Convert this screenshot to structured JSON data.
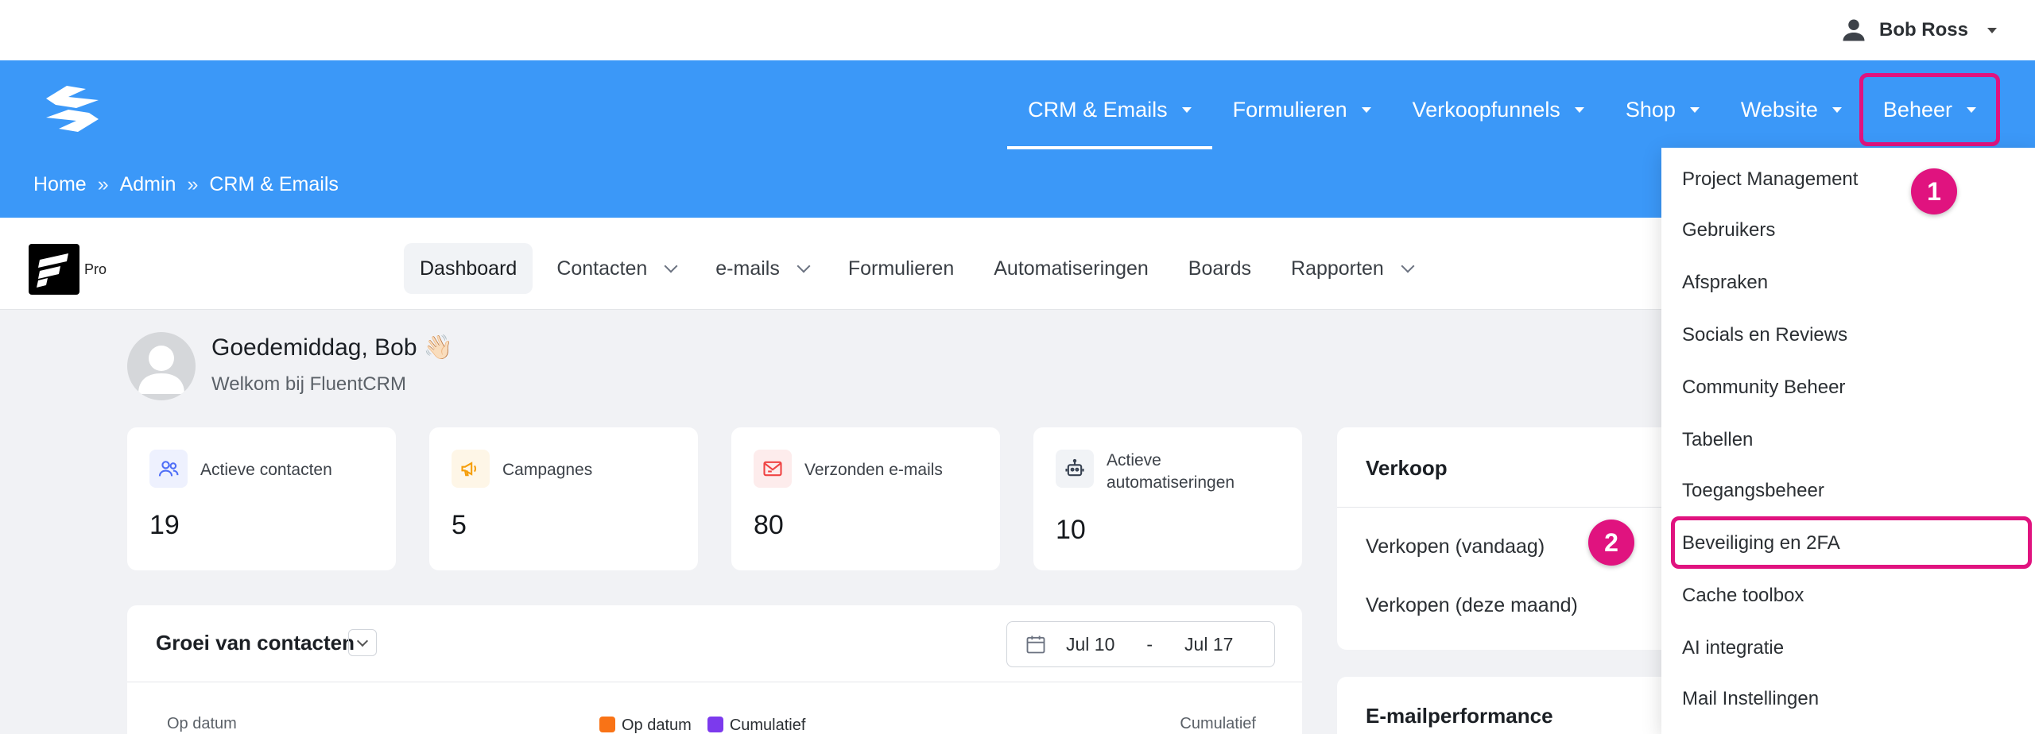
{
  "user": {
    "name": "Bob Ross",
    "icon": "user-icon"
  },
  "nav": {
    "items": [
      {
        "label": "CRM & Emails",
        "active": true
      },
      {
        "label": "Formulieren"
      },
      {
        "label": "Verkoopfunnels"
      },
      {
        "label": "Shop"
      },
      {
        "label": "Website"
      },
      {
        "label": "Beheer",
        "highlighted": true
      }
    ]
  },
  "breadcrumb": {
    "items": [
      "Home",
      "Admin",
      "CRM & Emails"
    ],
    "separator": "»"
  },
  "crm": {
    "pro_label": "Pro",
    "tabs": [
      {
        "label": "Dashboard",
        "active": true
      },
      {
        "label": "Contacten",
        "has_dropdown": true
      },
      {
        "label": "e-mails",
        "has_dropdown": true
      },
      {
        "label": "Formulieren"
      },
      {
        "label": "Automatiseringen"
      },
      {
        "label": "Boards"
      },
      {
        "label": "Rapporten",
        "has_dropdown": true
      }
    ]
  },
  "greeting": {
    "title": "Goedemiddag, Bob 👋🏻",
    "subtitle": "Welkom bij FluentCRM"
  },
  "stats": [
    {
      "label": "Actieve contacten",
      "value": "19",
      "icon": "users-icon",
      "color": "#4f6ef7",
      "bg": "#eef1fe"
    },
    {
      "label": "Campagnes",
      "value": "5",
      "icon": "megaphone-icon",
      "color": "#f59e0b",
      "bg": "#fef6e7"
    },
    {
      "label": "Verzonden e-mails",
      "value": "80",
      "icon": "mail-sent-icon",
      "color": "#ef4444",
      "bg": "#fdecec"
    },
    {
      "label": "Actieve automatiseringen",
      "value": "10",
      "icon": "robot-icon",
      "color": "#374151",
      "bg": "#f1f3f6"
    }
  ],
  "chart": {
    "title": "Groei van contacten",
    "date_from": "Jul 10",
    "date_sep": "-",
    "date_to": "Jul 17",
    "left_axis": "Op datum",
    "right_axis": "Cumulatief",
    "legend": [
      {
        "label": "Op datum",
        "color": "#f97316"
      },
      {
        "label": "Cumulatief",
        "color": "#7c3aed"
      }
    ]
  },
  "verkoop": {
    "title": "Verkoop",
    "rows": [
      "Verkopen (vandaag)",
      "Verkopen (deze maand)"
    ]
  },
  "email_perf": {
    "title": "E-mailperformance"
  },
  "beheer_menu": {
    "items": [
      "Project Management",
      "Gebruikers",
      "Afspraken",
      "Socials en Reviews",
      "Community Beheer",
      "Tabellen",
      "Toegangsbeheer",
      "Beveiliging en 2FA",
      "Cache toolbox",
      "AI integratie",
      "Mail Instellingen"
    ],
    "highlighted_index": 7
  },
  "markers": [
    "1",
    "2"
  ],
  "colors": {
    "header_blue": "#3b98f8",
    "highlight_pink": "#e0137f"
  }
}
